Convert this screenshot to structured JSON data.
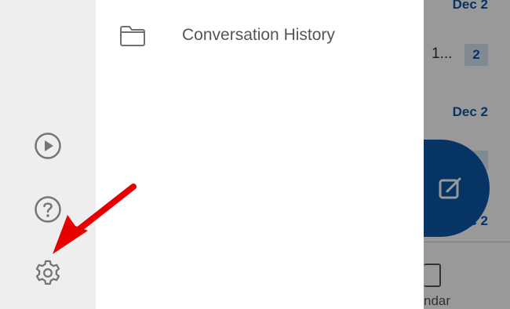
{
  "background": {
    "dates": [
      "Dec 2",
      "Dec 2",
      "Dec 2"
    ],
    "partial_text": "1...",
    "badge_count": "2",
    "bottom_tab_label_partial": "ndar"
  },
  "drawer": {
    "rail_icons": [
      "play-icon",
      "help-icon",
      "settings-icon"
    ],
    "folders": [
      {
        "icon": "folder-icon",
        "label": "Conversation History"
      }
    ]
  },
  "fab": {
    "icon": "compose-icon"
  },
  "annotation": {
    "color": "#e60000",
    "target": "settings-icon"
  },
  "colors": {
    "accent": "#0b57a8",
    "rail_bg": "#eeeeee",
    "scrim": "rgba(0,0,0,0.40)"
  }
}
